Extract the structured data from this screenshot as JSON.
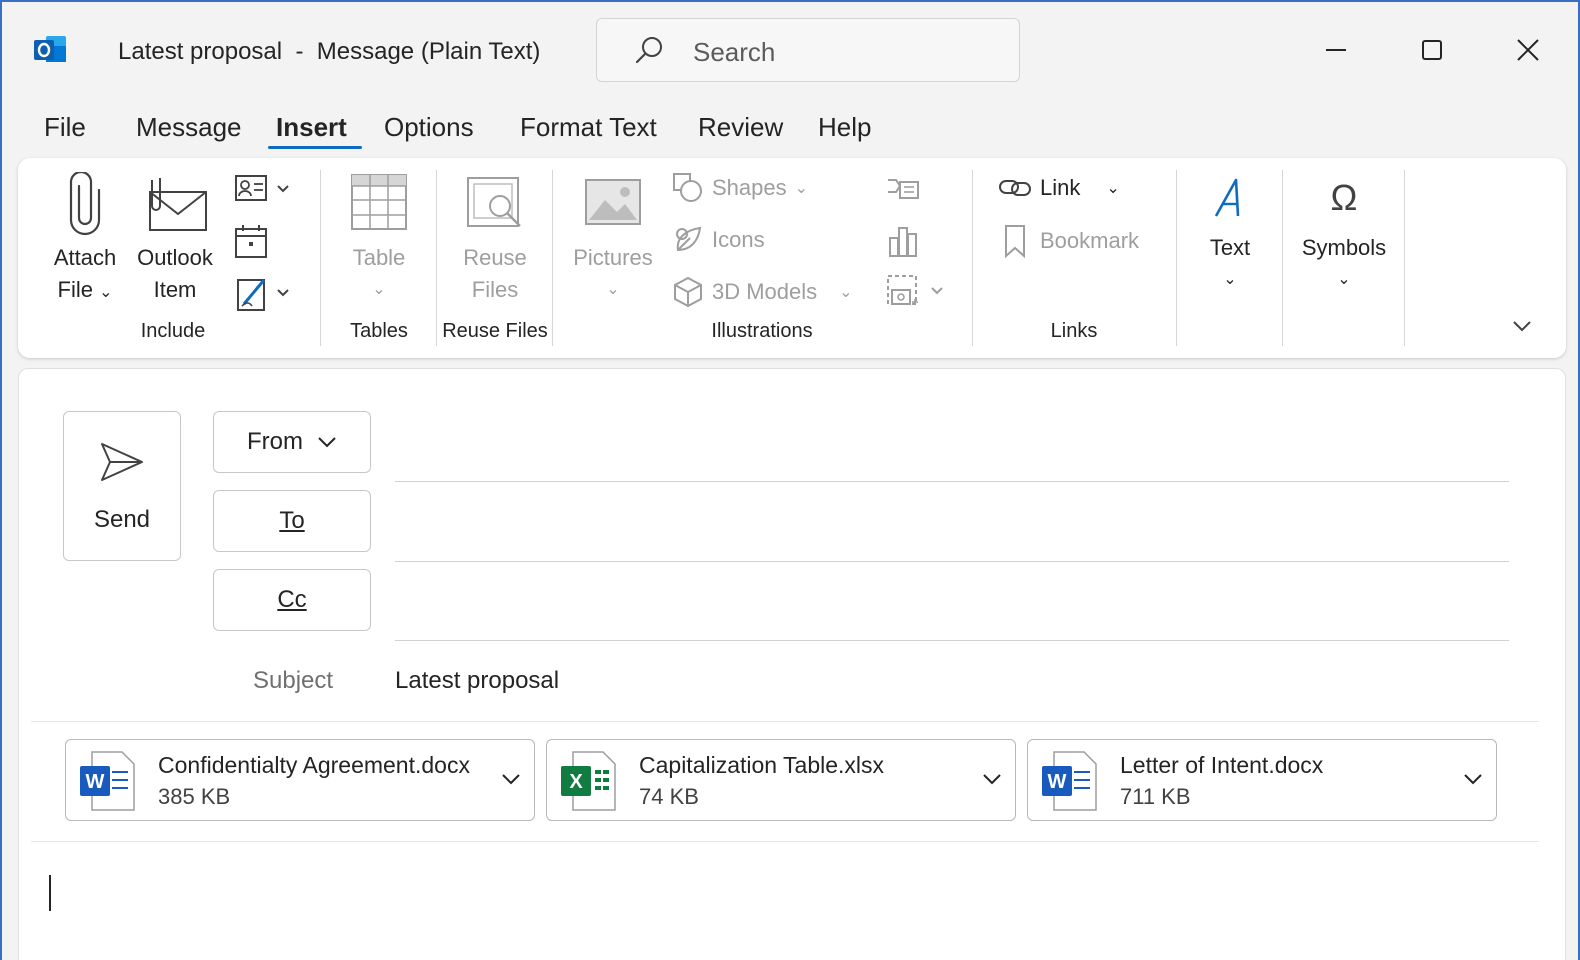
{
  "window": {
    "title": "Latest proposal  -  Message (Plain Text)",
    "search_placeholder": "Search",
    "app_icon": "outlook-icon",
    "controls": [
      "minimize-icon",
      "maximize-icon",
      "close-icon"
    ]
  },
  "menu": {
    "tabs": [
      "File",
      "Message",
      "Insert",
      "Options",
      "Format Text",
      "Review",
      "Help"
    ],
    "active": "Insert"
  },
  "ribbon": {
    "include": {
      "label": "Include",
      "attach_line1": "Attach",
      "attach_line2": "File",
      "outlook_line1": "Outlook",
      "outlook_line2": "Item"
    },
    "tables": {
      "label": "Tables",
      "table": "Table"
    },
    "reuse": {
      "label": "Reuse Files",
      "line1": "Reuse",
      "line2": "Files"
    },
    "illustrations": {
      "label": "Illustrations",
      "pictures": "Pictures",
      "shapes": "Shapes",
      "icons": "Icons",
      "models": "3D Models"
    },
    "links": {
      "label": "Links",
      "link": "Link",
      "bookmark": "Bookmark"
    },
    "text": {
      "label": "Text"
    },
    "symbols": {
      "label": "Symbols"
    }
  },
  "compose": {
    "send": "Send",
    "from": "From",
    "to": "To",
    "cc": "Cc",
    "subject_label": "Subject",
    "subject_value": "Latest proposal"
  },
  "attachments": [
    {
      "name": "Confidentialty Agreement.docx",
      "size": "385 KB",
      "type": "word"
    },
    {
      "name": "Capitalization Table.xlsx",
      "size": "74 KB",
      "type": "excel"
    },
    {
      "name": "Letter of Intent.docx",
      "size": "711 KB",
      "type": "word"
    }
  ],
  "colors": {
    "accent": "#0f6cbd",
    "word": "#185abd",
    "excel": "#107c41",
    "window_border": "#3b6fc2"
  }
}
